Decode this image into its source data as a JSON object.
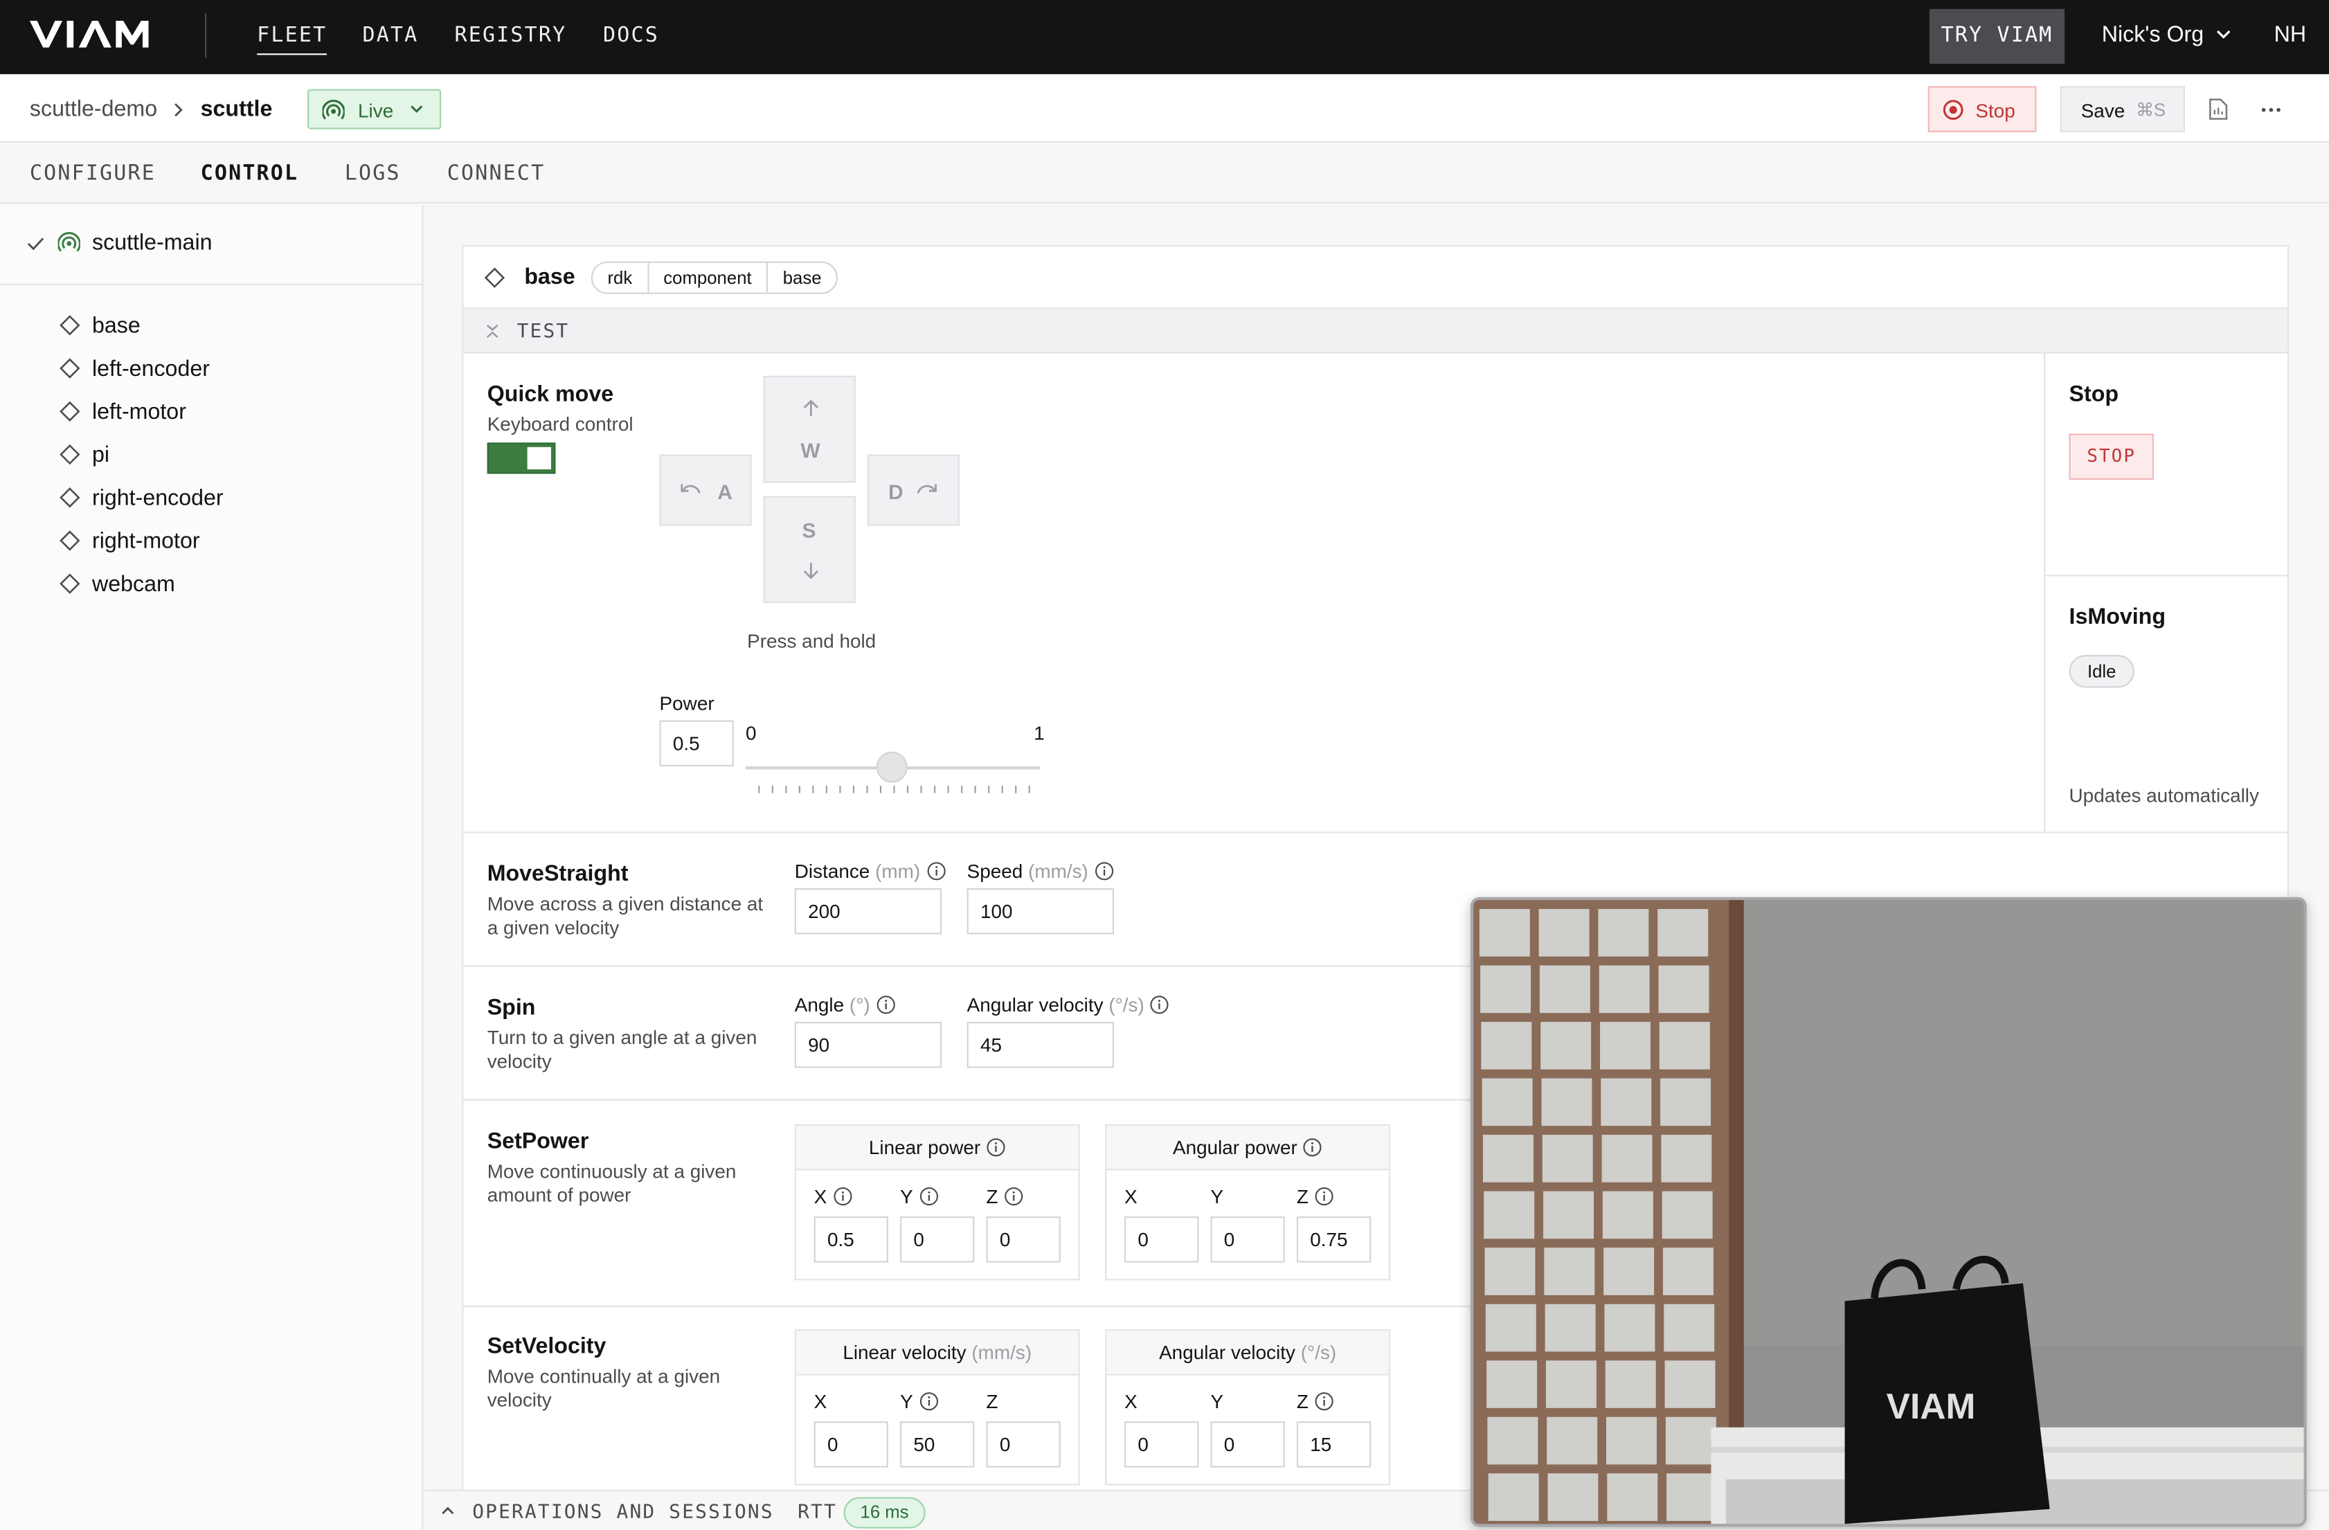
{
  "nav": {
    "brand": "VIAM",
    "items": [
      "FLEET",
      "DATA",
      "REGISTRY",
      "DOCS"
    ],
    "try_label": "TRY VIAM",
    "org_name": "Nick's Org",
    "avatar_initials": "NH"
  },
  "robot": {
    "location": "scuttle-demo",
    "name": "scuttle",
    "status": "Live",
    "stop_label": "Stop",
    "save_label": "Save",
    "save_shortcut": "⌘S"
  },
  "tabs": [
    "CONFIGURE",
    "CONTROL",
    "LOGS",
    "CONNECT"
  ],
  "active_tab": "CONTROL",
  "sidebar": {
    "part": "scuttle-main",
    "components": [
      "base",
      "left-encoder",
      "left-motor",
      "pi",
      "right-encoder",
      "right-motor",
      "webcam"
    ]
  },
  "card": {
    "title": "base",
    "tags": [
      "rdk",
      "component",
      "base"
    ],
    "section_label": "TEST",
    "quick_move": {
      "title": "Quick move",
      "subtitle": "Keyboard control",
      "keyboard_enabled": true,
      "keys": {
        "up": "W",
        "left": "A",
        "down": "S",
        "right": "D"
      },
      "hint": "Press and hold",
      "power_label": "Power",
      "power_value": "0.5",
      "slider_min": "0",
      "slider_max": "1"
    },
    "stop": {
      "title": "Stop",
      "button": "STOP"
    },
    "is_moving": {
      "title": "IsMoving",
      "state": "Idle",
      "note": "Updates automatically"
    },
    "move_straight": {
      "title": "MoveStraight",
      "desc": "Move across a given distance at a given velocity",
      "distance_label": "Distance",
      "distance_unit": "(mm)",
      "distance_value": "200",
      "speed_label": "Speed",
      "speed_unit": "(mm/s)",
      "speed_value": "100"
    },
    "spin": {
      "title": "Spin",
      "desc": "Turn to a given angle at a given velocity",
      "angle_label": "Angle",
      "angle_unit": "(°)",
      "angle_value": "90",
      "velocity_label": "Angular velocity",
      "velocity_unit": "(°/s)",
      "velocity_value": "45"
    },
    "set_power": {
      "title": "SetPower",
      "desc": "Move continuously at a given amount of power",
      "linear_label": "Linear power",
      "angular_label": "Angular power",
      "linear": {
        "x": "0.5",
        "y": "0",
        "z": "0"
      },
      "angular": {
        "x": "0",
        "y": "0",
        "z": "0.75"
      }
    },
    "set_velocity": {
      "title": "SetVelocity",
      "desc": "Move continually at a given velocity",
      "linear_label": "Linear velocity",
      "linear_unit": "(mm/s)",
      "angular_label": "Angular velocity",
      "angular_unit": "(°/s)",
      "linear": {
        "x": "0",
        "y": "50",
        "z": "0"
      },
      "angular": {
        "x": "0",
        "y": "0",
        "z": "15"
      }
    },
    "axis_labels": {
      "x": "X",
      "y": "Y",
      "z": "Z"
    }
  },
  "ops": {
    "label": "OPERATIONS AND SESSIONS",
    "rtt_label": "RTT",
    "rtt_value": "16 ms"
  },
  "camera": {
    "bag_logo": "VIAM"
  },
  "colors": {
    "accent_green": "#3d7d3f",
    "danger_red": "#be3536",
    "nav_bg": "#131414"
  }
}
